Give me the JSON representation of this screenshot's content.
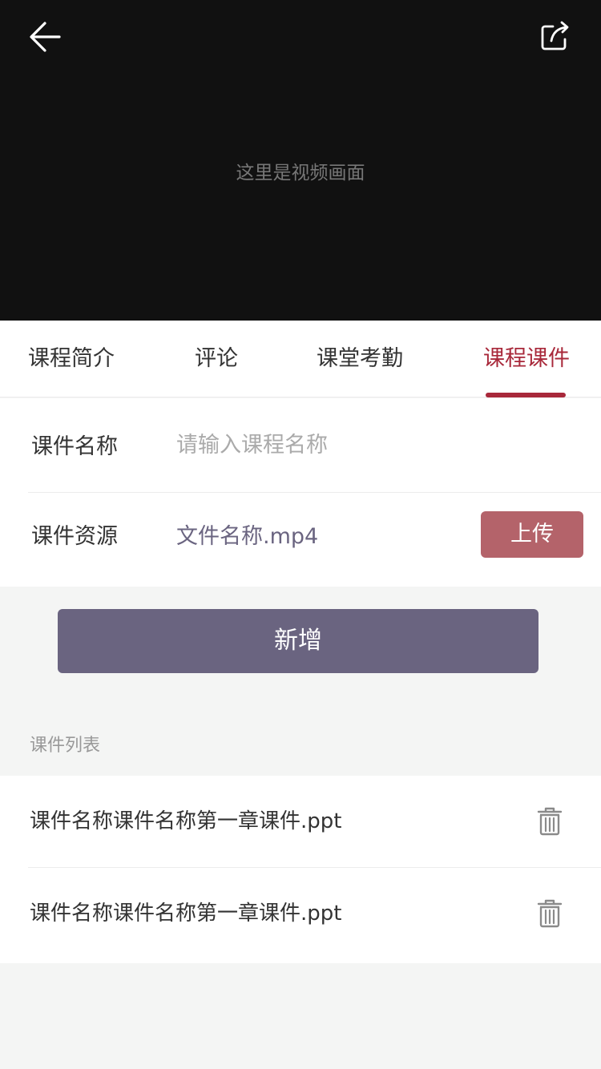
{
  "video": {
    "placeholder_text": "这里是视频画面",
    "back_icon": "arrow-left-icon",
    "share_icon": "share-icon"
  },
  "tabs": [
    {
      "label": "课程简介",
      "active": false
    },
    {
      "label": "评论",
      "active": false
    },
    {
      "label": "课堂考勤",
      "active": false
    },
    {
      "label": "课程课件",
      "active": true
    }
  ],
  "form": {
    "name_label": "课件名称",
    "name_value": "",
    "name_placeholder": "请输入课程名称",
    "resource_label": "课件资源",
    "resource_value": "文件名称.mp4",
    "upload_label": "上传"
  },
  "actions": {
    "add_label": "新增"
  },
  "list": {
    "title": "课件列表",
    "items": [
      {
        "name": "课件名称课件名称第一章课件.ppt",
        "icon": "trash-icon"
      },
      {
        "name": "课件名称课件名称第一章课件.ppt",
        "icon": "trash-icon"
      }
    ]
  },
  "colors": {
    "accent": "#a8283a",
    "primary_button": "#6a6480",
    "upload_button": "#b4636a",
    "video_background": "#111111",
    "page_background": "#f4f5f4"
  }
}
